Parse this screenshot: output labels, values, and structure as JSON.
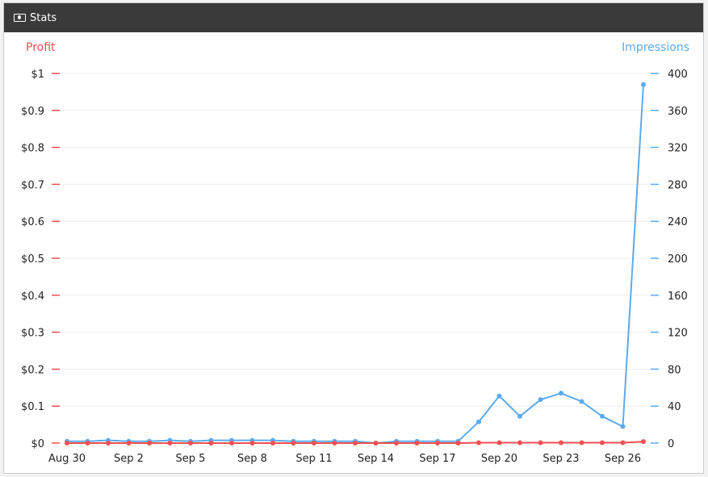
{
  "header": {
    "title": "Stats",
    "icon": "money-icon"
  },
  "chart_data": {
    "type": "line",
    "x": [
      "Aug 30",
      "Aug 31",
      "Sep 1",
      "Sep 2",
      "Sep 3",
      "Sep 4",
      "Sep 5",
      "Sep 6",
      "Sep 7",
      "Sep 8",
      "Sep 9",
      "Sep 10",
      "Sep 11",
      "Sep 12",
      "Sep 13",
      "Sep 14",
      "Sep 15",
      "Sep 16",
      "Sep 17",
      "Sep 18",
      "Sep 19",
      "Sep 20",
      "Sep 21",
      "Sep 22",
      "Sep 23",
      "Sep 24",
      "Sep 25",
      "Sep 26",
      "Sep 27"
    ],
    "x_tick_labels": [
      "Aug 30",
      "Sep 2",
      "Sep 5",
      "Sep 8",
      "Sep 11",
      "Sep 14",
      "Sep 17",
      "Sep 20",
      "Sep 23",
      "Sep 26"
    ],
    "x_tick_indices": [
      0,
      3,
      6,
      9,
      12,
      15,
      18,
      21,
      24,
      27
    ],
    "y_left": {
      "label": "Profit",
      "ylim": [
        0,
        1
      ],
      "ticks": [
        "$0",
        "$0.1",
        "$0.2",
        "$0.3",
        "$0.4",
        "$0.5",
        "$0.6",
        "$0.7",
        "$0.8",
        "$0.9",
        "$1"
      ],
      "color": "#f05050"
    },
    "y_right": {
      "label": "Impressions",
      "ylim": [
        0,
        400
      ],
      "ticks": [
        "0",
        "40",
        "80",
        "120",
        "160",
        "200",
        "240",
        "280",
        "320",
        "360",
        "400"
      ],
      "color": "#5aabf0"
    },
    "series": [
      {
        "name": "Impressions",
        "axis": "right",
        "color": "#5aabf0",
        "values": [
          2,
          2,
          3,
          2,
          2,
          3,
          2,
          3,
          3,
          3,
          3,
          2,
          2,
          2,
          2,
          0,
          2,
          2,
          2,
          2,
          23,
          51,
          29,
          47,
          54,
          45,
          29,
          18,
          388
        ]
      },
      {
        "name": "Profit",
        "axis": "left",
        "color": "#f05050",
        "values": [
          0,
          0,
          0,
          0,
          0,
          0,
          0,
          0,
          0,
          0,
          0,
          0,
          0,
          0,
          0,
          0,
          0,
          0,
          0,
          0,
          0.001,
          0.001,
          0.001,
          0.001,
          0.001,
          0.001,
          0.001,
          0.001,
          0.004
        ]
      }
    ],
    "grid": true,
    "legend": "none"
  }
}
